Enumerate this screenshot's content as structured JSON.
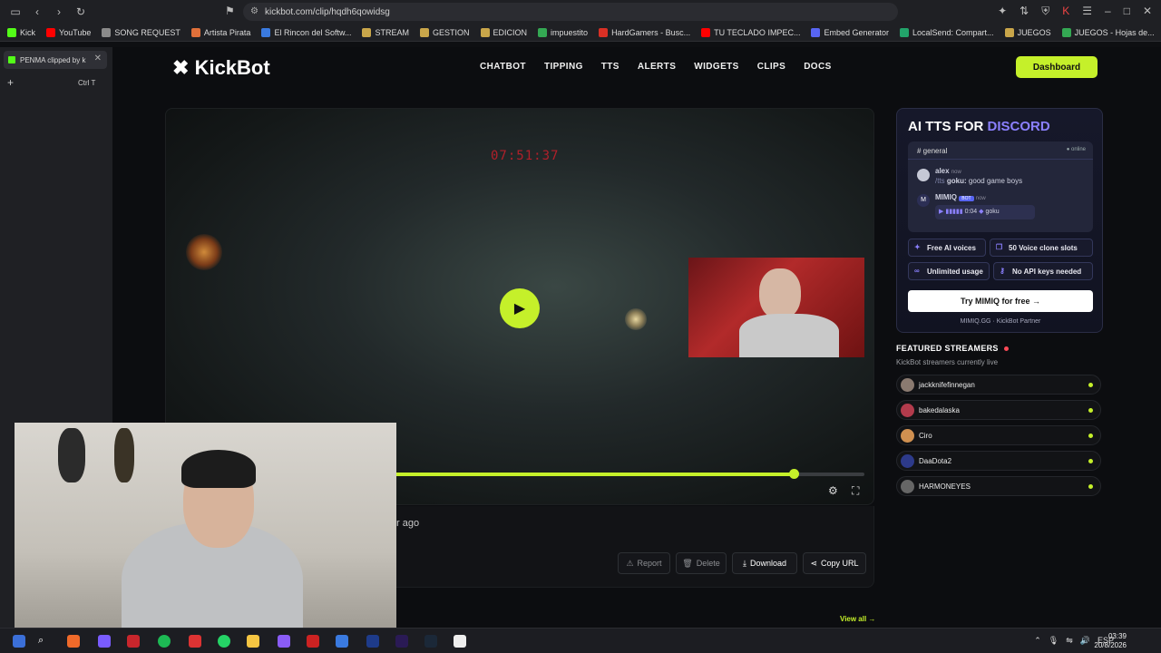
{
  "browser": {
    "url": "kickbot.com/clip/hqdh6qowidsg",
    "bookmarks": [
      {
        "label": "Kick",
        "color": "#53fc18"
      },
      {
        "label": "YouTube",
        "color": "#ff0000"
      },
      {
        "label": "SONG REQUEST",
        "color": "#8a8a8a"
      },
      {
        "label": "Artista Pirata",
        "color": "#e0703a"
      },
      {
        "label": "El Rincon del Softw...",
        "color": "#3a7ae0"
      },
      {
        "label": "STREAM",
        "color": "#c9a64a"
      },
      {
        "label": "GESTION",
        "color": "#c9a64a"
      },
      {
        "label": "EDICION",
        "color": "#c9a64a"
      },
      {
        "label": "impuestito",
        "color": "#34a853"
      },
      {
        "label": "HardGamers - Busc...",
        "color": "#d93025"
      },
      {
        "label": "TU TECLADO IMPEC...",
        "color": "#ff0000"
      },
      {
        "label": "Embed Generator",
        "color": "#5865f2"
      },
      {
        "label": "LocalSend: Compart...",
        "color": "#22a36a"
      },
      {
        "label": "JUEGOS",
        "color": "#c9a64a"
      },
      {
        "label": "JUEGOS - Hojas de...",
        "color": "#34a853"
      }
    ],
    "tab_title": "PENMA clipped by k",
    "new_tab_hint": "Ctrl  T"
  },
  "site": {
    "logo": "KickBot",
    "nav": [
      "CHATBOT",
      "TIPPING",
      "TTS",
      "ALERTS",
      "WIDGETS",
      "CLIPS",
      "DOCS"
    ],
    "dashboard_label": "Dashboard",
    "accent": "#c5f02a"
  },
  "player": {
    "timecode": "07:51:37",
    "progress": 0.85
  },
  "clip_meta": {
    "time_ago_fragment": "r ago",
    "report_label": "Report",
    "delete_label": "Delete",
    "download_label": "Download",
    "copy_url_label": "Copy URL"
  },
  "ad": {
    "title_prefix": "AI TTS FOR ",
    "title_accent": "DISCORD",
    "channel": "# general",
    "online": "● online",
    "msg1_user": "alex",
    "msg1_time": "now",
    "msg1_cmd": "/tts",
    "msg1_voice": "goku:",
    "msg1_text": "good game boys",
    "msg2_user": "MIMIQ",
    "msg2_badge": "BOT",
    "msg2_time": "now",
    "audio_time": "0:04",
    "audio_voice": "goku",
    "chips": [
      "Free AI voices",
      "50 Voice clone slots",
      "Unlimited usage",
      "No API keys needed"
    ],
    "cta": "Try MIMIQ for free →",
    "partner": "MIMIQ.GG · KickBot Partner"
  },
  "featured": {
    "title": "FEATURED STREAMERS",
    "subtitle": "KickBot streamers currently live",
    "streamers": [
      "jackknifefinnegan",
      "bakedalaska",
      "Ciro",
      "DaaDota2",
      "HARMONEYES"
    ],
    "view_all": "View all →"
  },
  "taskbar": {
    "lang": "ESP",
    "time": "03:39",
    "date": "20/8/2026"
  }
}
